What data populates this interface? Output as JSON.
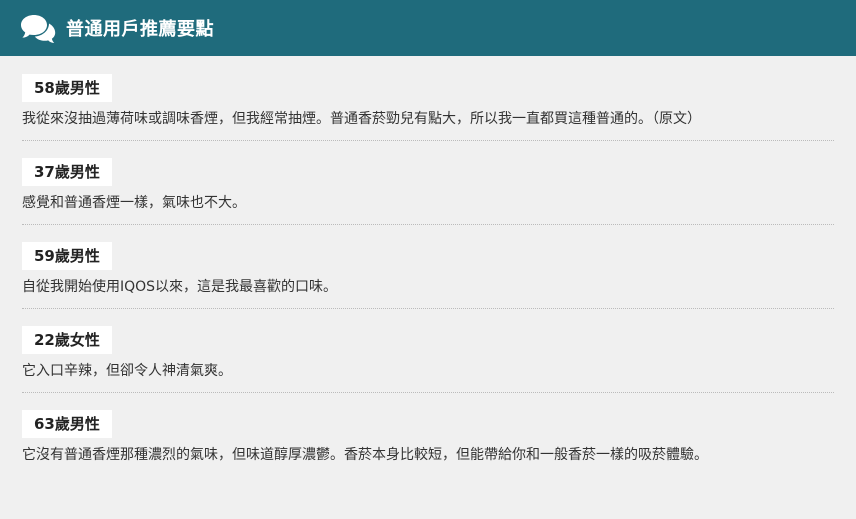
{
  "header": {
    "title": "普通用戶推薦要點",
    "icon": "speech-bubbles-icon",
    "color": "#1f6b7c"
  },
  "reviews": [
    {
      "user": "58歲男性",
      "text": "我從來沒抽過薄荷味或調味香煙，但我經常抽煙。普通香菸勁兒有點大，所以我一直都買這種普通的。（原文）"
    },
    {
      "user": "37歲男性",
      "text": "感覺和普通香煙一樣，氣味也不大。"
    },
    {
      "user": "59歲男性",
      "text": "自從我開始使用IQOS以來，這是我最喜歡的口味。"
    },
    {
      "user": "22歲女性",
      "text": "它入口辛辣，但卻令人神清氣爽。"
    },
    {
      "user": "63歲男性",
      "text": "它沒有普通香煙那種濃烈的氣味，但味道醇厚濃鬱。香菸本身比較短，但能帶給你和一般香菸一樣的吸菸體驗。"
    }
  ]
}
